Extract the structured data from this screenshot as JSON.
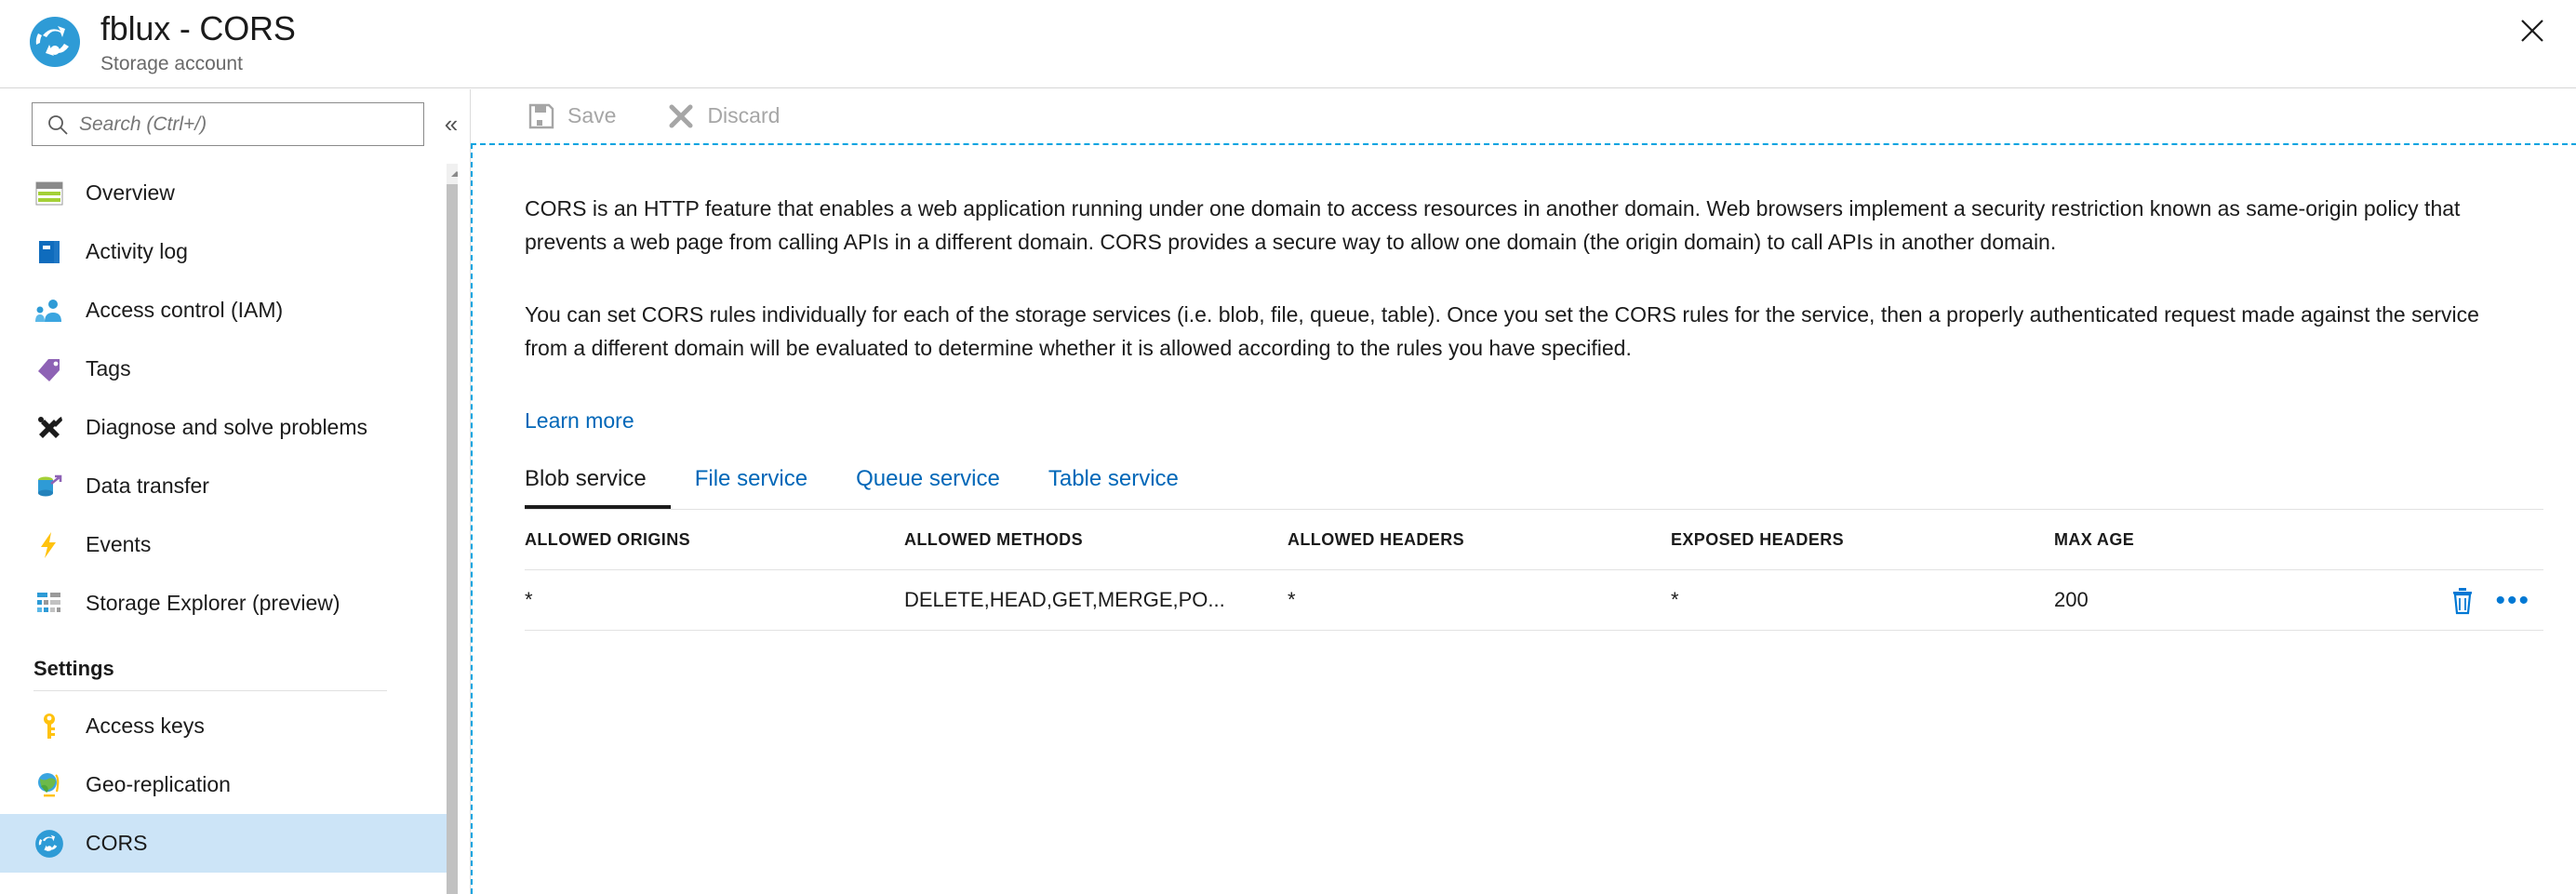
{
  "header": {
    "title": "fblux - CORS",
    "subtitle": "Storage account",
    "icon": "storage-account-icon",
    "close_label": "Close",
    "close_icon": "close-icon"
  },
  "sidebar": {
    "search": {
      "placeholder": "Search (Ctrl+/)",
      "value": "",
      "icon": "search-icon"
    },
    "collapse_icon": "chevron-double-left-icon",
    "items": [
      {
        "label": "Overview",
        "icon": "overview-icon",
        "selected": false
      },
      {
        "label": "Activity log",
        "icon": "activity-log-icon",
        "selected": false
      },
      {
        "label": "Access control (IAM)",
        "icon": "access-control-icon",
        "selected": false
      },
      {
        "label": "Tags",
        "icon": "tags-icon",
        "selected": false
      },
      {
        "label": "Diagnose and solve problems",
        "icon": "diagnose-icon",
        "selected": false
      },
      {
        "label": "Data transfer",
        "icon": "data-transfer-icon",
        "selected": false
      },
      {
        "label": "Events",
        "icon": "events-icon",
        "selected": false
      },
      {
        "label": "Storage Explorer (preview)",
        "icon": "storage-explorer-icon",
        "selected": false
      }
    ],
    "settings_section": {
      "label": "Settings",
      "items": [
        {
          "label": "Access keys",
          "icon": "key-icon",
          "selected": false
        },
        {
          "label": "Geo-replication",
          "icon": "globe-icon",
          "selected": false
        },
        {
          "label": "CORS",
          "icon": "cors-icon",
          "selected": true
        }
      ]
    }
  },
  "toolbar": {
    "save_label": "Save",
    "save_icon": "save-icon",
    "discard_label": "Discard",
    "discard_icon": "discard-x-icon"
  },
  "main": {
    "paragraph_1": "CORS is an HTTP feature that enables a web application running under one domain to access resources in another domain. Web browsers implement a security restriction known as same-origin policy that prevents a web page from calling APIs in a different domain. CORS provides a secure way to allow one domain (the origin domain) to call APIs in another domain.",
    "paragraph_2": "You can set CORS rules individually for each of the storage services (i.e. blob, file, queue, table). Once you set the CORS rules for the service, then a properly authenticated request made against the service from a different domain will be evaluated to determine whether it is allowed according to the rules you have specified.",
    "learn_more": "Learn more",
    "tabs": [
      {
        "label": "Blob service",
        "active": true
      },
      {
        "label": "File service",
        "active": false
      },
      {
        "label": "Queue service",
        "active": false
      },
      {
        "label": "Table service",
        "active": false
      }
    ],
    "table": {
      "columns": [
        "ALLOWED ORIGINS",
        "ALLOWED METHODS",
        "ALLOWED HEADERS",
        "EXPOSED HEADERS",
        "MAX AGE"
      ],
      "rows": [
        {
          "allowed_origins": "*",
          "allowed_methods": "DELETE,HEAD,GET,MERGE,PO...",
          "allowed_headers": "*",
          "exposed_headers": "*",
          "max_age": "200",
          "delete_icon": "trash-icon",
          "more_icon": "ellipsis-icon"
        }
      ]
    }
  },
  "colors": {
    "accent_blue": "#0067b8",
    "link_blue": "#0078d4",
    "selected_row": "#cce4f7",
    "dashed_border": "#00a3e0",
    "disabled_text": "#a6a6a6"
  }
}
